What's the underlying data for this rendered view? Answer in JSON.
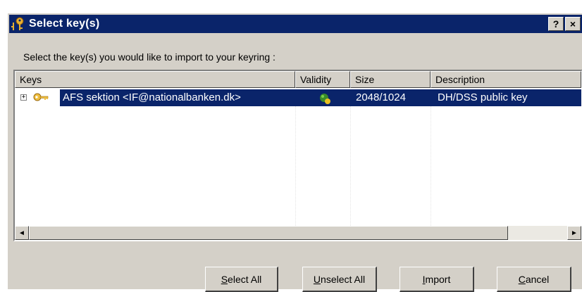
{
  "window": {
    "title": "Select key(s)",
    "help_label": "?",
    "close_label": "×"
  },
  "prompt": "Select the key(s) you would like to import to your keyring :",
  "columns": {
    "keys": "Keys",
    "validity": "Validity",
    "size": "Size",
    "description": "Description"
  },
  "rows": [
    {
      "expander": "+",
      "name": "AFS sektion <IF@nationalbanken.dk>",
      "validity_icon": "validity-icon",
      "size": "2048/1024",
      "description": "DH/DSS public key",
      "selected": true
    }
  ],
  "scrollbar": {
    "left_arrow": "◄",
    "right_arrow": "►"
  },
  "buttons": {
    "select_all": {
      "mnemonic": "S",
      "rest": "elect All"
    },
    "unselect_all": {
      "mnemonic": "U",
      "rest": "nselect All"
    },
    "import": {
      "mnemonic": "I",
      "rest": "mport"
    },
    "cancel": {
      "mnemonic": "C",
      "rest": "ancel"
    }
  },
  "colors": {
    "titlebar": "#0a246a",
    "selection": "#0a246a",
    "dialog_face": "#d4d0c8"
  }
}
